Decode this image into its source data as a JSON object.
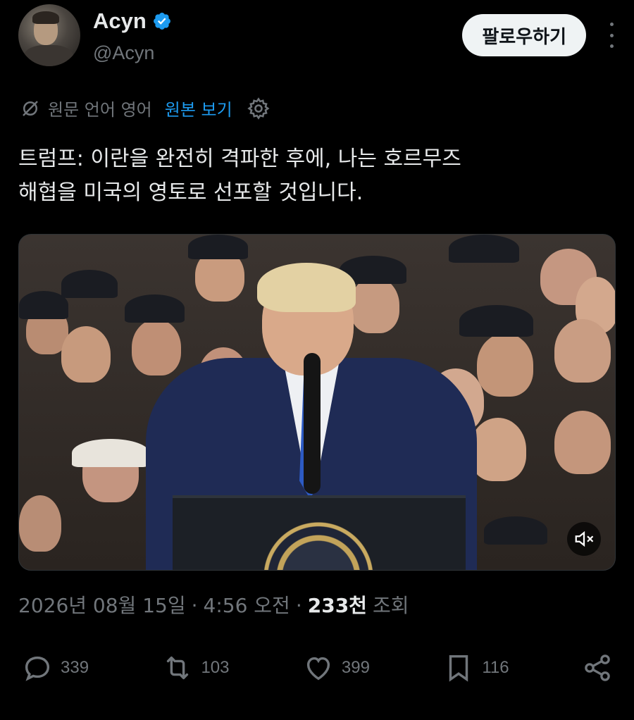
{
  "author": {
    "name": "Acyn",
    "handle": "@Acyn",
    "follow_label": "팔로우하기"
  },
  "translation": {
    "label": "원문 언어 영어",
    "show_original_label": "원본 보기"
  },
  "tweet": {
    "text_line1": "트럼프: 이란을 완전히 격파한 후에, 나는 호르무즈",
    "text_line2": "해협을 미국의 영토로 선포할 것입니다."
  },
  "meta": {
    "date": "2026년 08월 15일",
    "sep1": "·",
    "time": "4:56 오전",
    "sep2": "·",
    "views_count": "233천",
    "views_label": "조회"
  },
  "actions": {
    "replies": "339",
    "reposts": "103",
    "likes": "399",
    "bookmarks": "116"
  },
  "colors": {
    "accent": "#1d9bf0",
    "verified": "#1d9bf0",
    "muted": "#71767b",
    "text": "#e7e9ea",
    "background": "#000000"
  },
  "icons": [
    "verified-badge-icon",
    "more-icon",
    "translate-icon",
    "gear-icon",
    "mute-icon",
    "reply-icon",
    "repost-icon",
    "like-icon",
    "bookmark-icon",
    "share-icon"
  ]
}
